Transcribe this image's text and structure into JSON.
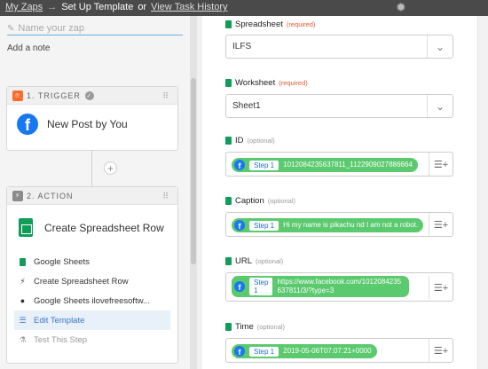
{
  "topbar": {
    "my_zaps": "My Zaps",
    "arrow": "→",
    "current": "Set Up Template",
    "or": "or",
    "history": "View Task History",
    "settings_icon": "gear-icon"
  },
  "editor": {
    "zap_name_placeholder": "Name your zap",
    "add_note": "Add a note",
    "trigger": {
      "label": "1. TRIGGER",
      "app_icon": "facebook-icon",
      "title": "New Post by You"
    },
    "action": {
      "label": "2. ACTION",
      "app_icon": "google-sheets-icon",
      "title": "Create Spreadsheet Row",
      "steps": [
        {
          "icon": "google-sheets-icon",
          "label": "Google Sheets"
        },
        {
          "icon": "bolt-icon",
          "label": "Create Spreadsheet Row"
        },
        {
          "icon": "user-icon",
          "label": "Google Sheets ilovefreesoftw..."
        },
        {
          "icon": "list-icon",
          "label": "Edit Template"
        },
        {
          "icon": "flask-icon",
          "label": "Test This Step"
        }
      ]
    }
  },
  "template": {
    "spreadsheet": {
      "label": "Spreadsheet",
      "tag": "(required)",
      "value": "ILFS"
    },
    "worksheet": {
      "label": "Worksheet",
      "tag": "(required)",
      "value": "Sheet1"
    },
    "fields": [
      {
        "label": "ID",
        "tag": "(optional)",
        "step": "Step 1",
        "value": "1012084235637811_1122909027886664"
      },
      {
        "label": "Caption",
        "tag": "(optional)",
        "step": "Step 1",
        "value": "Hi my name is pikachu nd I am not  a robot."
      },
      {
        "label": "URL",
        "tag": "(optional)",
        "step": "Step 1",
        "value": "https://www.facebook.com/1012084235637811/3/?type=3"
      },
      {
        "label": "Time",
        "tag": "(optional)",
        "step": "Step 1",
        "value": "2019-05-06T07:07:21+0000"
      }
    ]
  },
  "colors": {
    "topbar": "#4a4a4a",
    "pill_green": "#5bc96e",
    "facebook_blue": "#1877f2",
    "sheets_green": "#0f9d58",
    "trigger_orange": "#ff6b2c",
    "action_gray": "#8a8a8a"
  }
}
